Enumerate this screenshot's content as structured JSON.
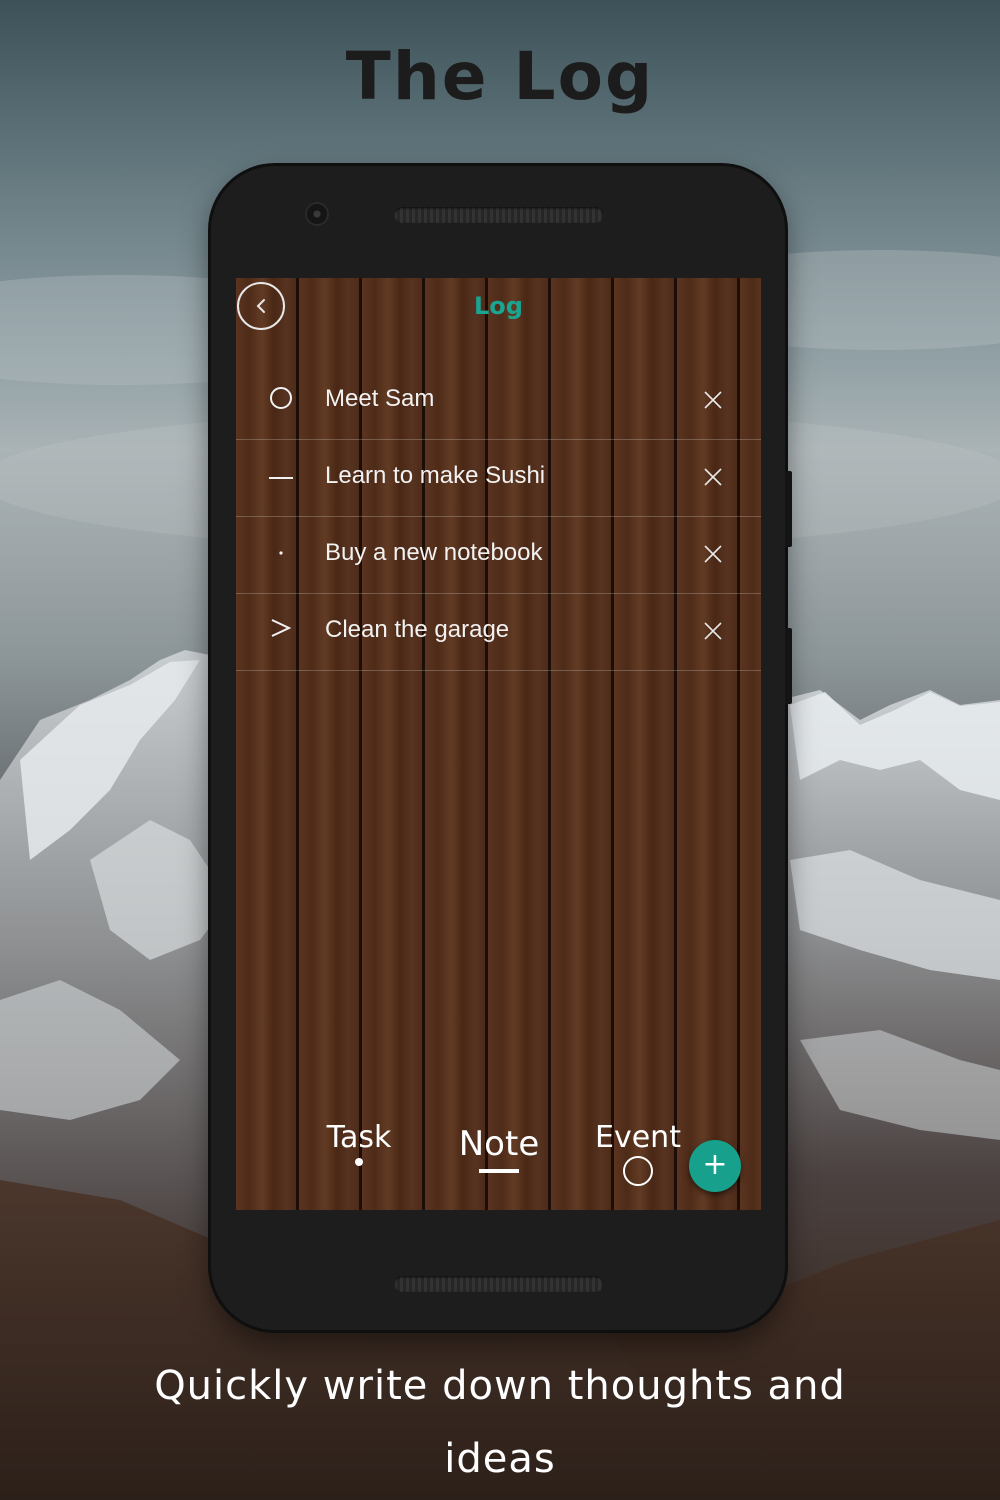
{
  "headline": "The Log",
  "caption": "Quickly write down thoughts and ideas",
  "app": {
    "title": "Log",
    "accent_color": "#1aa593",
    "back_icon": "chevron-left-icon"
  },
  "entries": [
    {
      "symbol": "circle-icon",
      "text": "Meet Sam",
      "delete_icon": "close-icon"
    },
    {
      "symbol": "dash-icon",
      "text": "Learn to make Sushi",
      "delete_icon": "close-icon"
    },
    {
      "symbol": "dot-icon",
      "text": "Buy a new notebook",
      "delete_icon": "close-icon"
    },
    {
      "symbol": "chevron-right-icon",
      "text": "Clean the garage",
      "delete_icon": "close-icon"
    }
  ],
  "tabs": [
    {
      "label": "Task",
      "indicator": "dot-icon"
    },
    {
      "label": "Note",
      "indicator": "dash-icon",
      "selected": true
    },
    {
      "label": "Event",
      "indicator": "circle-icon"
    }
  ],
  "fab": {
    "label": "+",
    "color": "#17a08c"
  }
}
